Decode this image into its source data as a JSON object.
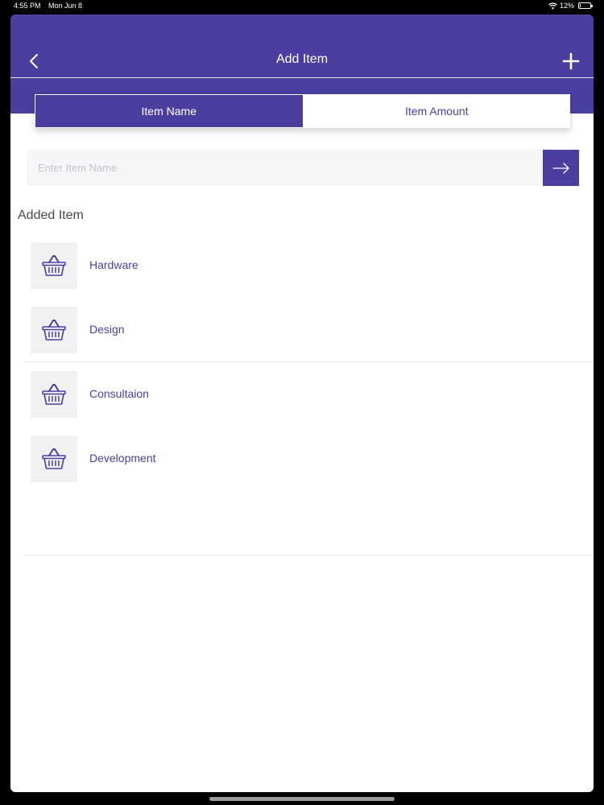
{
  "status_bar": {
    "time": "4:55 PM",
    "date": "Mon Jun 8",
    "battery": "12%",
    "battery_level": 0.12
  },
  "header": {
    "title": "Add Item"
  },
  "segments": [
    {
      "label": "Item Name",
      "active": true
    },
    {
      "label": "Item Amount",
      "active": false
    }
  ],
  "entry": {
    "placeholder": "Enter Item Name",
    "value": ""
  },
  "section": {
    "title": "Added Item"
  },
  "items": [
    {
      "label": "Hardware",
      "icon": "basket-icon"
    },
    {
      "label": "Design",
      "icon": "basket-icon"
    },
    {
      "label": "Consultaion",
      "icon": "basket-icon"
    },
    {
      "label": "Development",
      "icon": "basket-icon"
    }
  ],
  "colors": {
    "accent": "#4a3f9f",
    "thumb_bg": "#f1f1f3",
    "input_bg": "#f6f6f8"
  }
}
